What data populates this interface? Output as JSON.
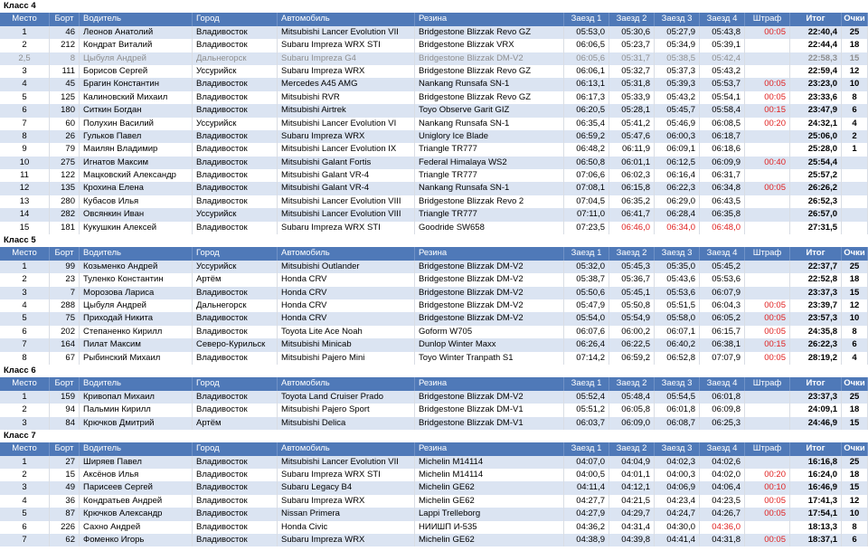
{
  "headers": [
    "Место",
    "Борт",
    "Водитель",
    "Город",
    "Автомобиль",
    "Резина",
    "Заезд 1",
    "Заезд 2",
    "Заезд 3",
    "Заезд 4",
    "Штраф",
    "Итог",
    "Очки"
  ],
  "colors": {
    "header_bg": "#4f79b8",
    "band": "#dbe4f2",
    "penalty": "#e02020",
    "withdrawn": "#8f8f8f"
  },
  "classes": [
    {
      "title": "Класс 4",
      "rows": [
        {
          "cells": [
            "1",
            "46",
            "Леонов Анатолий",
            "Владивосток",
            "Mitsubishi Lancer Evolution VII",
            "Bridgestone Blizzak Revo GZ",
            "05:53,0",
            "05:30,6",
            "05:27,9",
            "05:43,8",
            "00:05",
            "22:40,4",
            "25"
          ]
        },
        {
          "cells": [
            "2",
            "212",
            "Кондрат Виталий",
            "Владивосток",
            "Subaru Impreza WRX STI",
            "Bridgestone Blizzak VRX",
            "06:06,5",
            "05:23,7",
            "05:34,9",
            "05:39,1",
            "",
            "22:44,4",
            "18"
          ]
        },
        {
          "gray": true,
          "cells": [
            "2,5",
            "8",
            "Цыбуля Андрей",
            "Дальнегорск",
            "Subaru Impreza G4",
            "Bridgestone Blizzak DM-V2",
            "06:05,6",
            "05:31,7",
            "05:38,5",
            "05:42,4",
            "",
            "22:58,3",
            "15"
          ]
        },
        {
          "cells": [
            "3",
            "111",
            "Борисов Сергей",
            "Уссурийск",
            "Subaru Impreza WRX",
            "Bridgestone Blizzak Revo GZ",
            "06:06,1",
            "05:32,7",
            "05:37,3",
            "05:43,2",
            "",
            "22:59,4",
            "12"
          ]
        },
        {
          "cells": [
            "4",
            "45",
            "Брагин Константин",
            "Владивосток",
            "Mercedes A45 AMG",
            "Nankang Runsafa SN-1",
            "06:13,1",
            "05:31,8",
            "05:39,3",
            "05:53,7",
            "00:05",
            "23:23,0",
            "10"
          ]
        },
        {
          "cells": [
            "5",
            "125",
            "Калиновский Михаил",
            "Владивосток",
            "Mitsubishi RVR",
            "Bridgestone Blizzak Revo GZ",
            "06:17,3",
            "05:33,9",
            "05:43,2",
            "05:54,1",
            "00:05",
            "23:33,6",
            "8"
          ]
        },
        {
          "cells": [
            "6",
            "180",
            "Ситкин Богдан",
            "Владивосток",
            "Mitsubishi Airtrek",
            "Toyo Observe Garit GIZ",
            "06:20,5",
            "05:28,1",
            "05:45,7",
            "05:58,4",
            "00:15",
            "23:47,9",
            "6"
          ]
        },
        {
          "cells": [
            "7",
            "60",
            "Полухин Василий",
            "Уссурийск",
            "Mitsubishi Lancer Evolution VI",
            "Nankang Runsafa SN-1",
            "06:35,4",
            "05:41,2",
            "05:46,9",
            "06:08,5",
            "00:20",
            "24:32,1",
            "4"
          ]
        },
        {
          "cells": [
            "8",
            "26",
            "Гульков Павел",
            "Владивосток",
            "Subaru Impreza WRX",
            "Uniglory Ice Blade",
            "06:59,2",
            "05:47,6",
            "06:00,3",
            "06:18,7",
            "",
            "25:06,0",
            "2"
          ]
        },
        {
          "cells": [
            "9",
            "79",
            "Маилян Владимир",
            "Владивосток",
            "Mitsubishi Lancer Evolution IX",
            "Triangle TR777",
            "06:48,2",
            "06:11,9",
            "06:09,1",
            "06:18,6",
            "",
            "25:28,0",
            "1"
          ]
        },
        {
          "cells": [
            "10",
            "275",
            "Игнатов Максим",
            "Владивосток",
            "Mitsubishi Galant Fortis",
            "Federal Himalaya WS2",
            "06:50,8",
            "06:01,1",
            "06:12,5",
            "06:09,9",
            "00:40",
            "25:54,4",
            ""
          ]
        },
        {
          "cells": [
            "11",
            "122",
            "Мацковский Александр",
            "Владивосток",
            "Mitsubishi Galant VR-4",
            "Triangle TR777",
            "07:06,6",
            "06:02,3",
            "06:16,4",
            "06:31,7",
            "",
            "25:57,2",
            ""
          ]
        },
        {
          "cells": [
            "12",
            "135",
            "Крохина Елена",
            "Владивосток",
            "Mitsubishi Galant VR-4",
            "Nankang Runsafa SN-1",
            "07:08,1",
            "06:15,8",
            "06:22,3",
            "06:34,8",
            "00:05",
            "26:26,2",
            ""
          ]
        },
        {
          "cells": [
            "13",
            "280",
            "Кубасов Илья",
            "Владивосток",
            "Mitsubishi Lancer Evolution VIII",
            "Bridgestone Blizzak Revo 2",
            "07:04,5",
            "06:35,2",
            "06:29,0",
            "06:43,5",
            "",
            "26:52,3",
            ""
          ]
        },
        {
          "cells": [
            "14",
            "282",
            "Овсянкин Иван",
            "Уссурийск",
            "Mitsubishi Lancer Evolution VIII",
            "Triangle TR777",
            "07:11,0",
            "06:41,7",
            "06:28,4",
            "06:35,8",
            "",
            "26:57,0",
            ""
          ]
        },
        {
          "cells": [
            "15",
            "181",
            "Кукушкин Алексей",
            "Владивосток",
            "Subaru Impreza WRX STI",
            "Goodride SW658",
            "07:23,5",
            "06:46,0",
            "06:34,0",
            "06:48,0",
            "",
            "27:31,5",
            ""
          ],
          "red": [
            7,
            8,
            9
          ]
        }
      ]
    },
    {
      "title": "Класс 5",
      "rows": [
        {
          "cells": [
            "1",
            "99",
            "Козьменко Андрей",
            "Уссурийск",
            "Mitsubishi Outlander",
            "Bridgestone Blizzak DM-V2",
            "05:32,0",
            "05:45,3",
            "05:35,0",
            "05:45,2",
            "",
            "22:37,7",
            "25"
          ]
        },
        {
          "cells": [
            "2",
            "23",
            "Туленко Константин",
            "Артём",
            "Honda CRV",
            "Bridgestone Blizzak DM-V2",
            "05:38,7",
            "05:36,7",
            "05:43,6",
            "05:53,6",
            "",
            "22:52,8",
            "18"
          ]
        },
        {
          "cells": [
            "3",
            "7",
            "Морозова Лариса",
            "Владивосток",
            "Honda CRV",
            "Bridgestone Blizzak DM-V2",
            "05:50,6",
            "05:45,1",
            "05:53,6",
            "06:07,9",
            "",
            "23:37,3",
            "15"
          ]
        },
        {
          "cells": [
            "4",
            "288",
            "Цыбуля Андрей",
            "Дальнегорск",
            "Honda CRV",
            "Bridgestone Blizzak DM-V2",
            "05:47,9",
            "05:50,8",
            "05:51,5",
            "06:04,3",
            "00:05",
            "23:39,7",
            "12"
          ]
        },
        {
          "cells": [
            "5",
            "75",
            "Приходай Никита",
            "Владивосток",
            "Honda CRV",
            "Bridgestone Blizzak DM-V2",
            "05:54,0",
            "05:54,9",
            "05:58,0",
            "06:05,2",
            "00:05",
            "23:57,3",
            "10"
          ]
        },
        {
          "cells": [
            "6",
            "202",
            "Степаненко Кирилл",
            "Владивосток",
            "Toyota Lite Ace Noah",
            "Goform W705",
            "06:07,6",
            "06:00,2",
            "06:07,1",
            "06:15,7",
            "00:05",
            "24:35,8",
            "8"
          ]
        },
        {
          "cells": [
            "7",
            "164",
            "Пилат Максим",
            "Северо-Курильск",
            "Mitsubishi Minicab",
            "Dunlop Winter Maxx",
            "06:26,4",
            "06:22,5",
            "06:40,2",
            "06:38,1",
            "00:15",
            "26:22,3",
            "6"
          ]
        },
        {
          "cells": [
            "8",
            "67",
            "Рыбинский Михаил",
            "Владивосток",
            "Mitsubishi Pajero Mini",
            "Toyo Winter Tranpath S1",
            "07:14,2",
            "06:59,2",
            "06:52,8",
            "07:07,9",
            "00:05",
            "28:19,2",
            "4"
          ]
        }
      ]
    },
    {
      "title": "Класс 6",
      "rows": [
        {
          "cells": [
            "1",
            "159",
            "Кривопал Михаил",
            "Владивосток",
            "Toyota Land Cruiser Prado",
            "Bridgestone Blizzak DM-V2",
            "05:52,4",
            "05:48,4",
            "05:54,5",
            "06:01,8",
            "",
            "23:37,3",
            "25"
          ]
        },
        {
          "cells": [
            "2",
            "94",
            "Пальмин Кирилл",
            "Владивосток",
            "Mitsubishi Pajero Sport",
            "Bridgestone Blizzak DM-V1",
            "05:51,2",
            "06:05,8",
            "06:01,8",
            "06:09,8",
            "",
            "24:09,1",
            "18"
          ]
        },
        {
          "cells": [
            "3",
            "84",
            "Крючков Дмитрий",
            "Артём",
            "Mitsubishi Delica",
            "Bridgestone Blizzak DM-V1",
            "06:03,7",
            "06:09,0",
            "06:08,7",
            "06:25,3",
            "",
            "24:46,9",
            "15"
          ]
        }
      ]
    },
    {
      "title": "Класс 7",
      "rows": [
        {
          "cells": [
            "1",
            "27",
            "Ширяев Павел",
            "Владивосток",
            "Mitsubishi Lancer Evolution VII",
            "Michelin M14114",
            "04:07,0",
            "04:04,9",
            "04:02,3",
            "04:02,6",
            "",
            "16:16,8",
            "25"
          ]
        },
        {
          "cells": [
            "2",
            "15",
            "Аксёнов Илья",
            "Владивосток",
            "Subaru Impreza WRX STI",
            "Michelin M14114",
            "04:00,5",
            "04:01,1",
            "04:00,3",
            "04:02,0",
            "00:20",
            "16:24,0",
            "18"
          ]
        },
        {
          "cells": [
            "3",
            "49",
            "Парисеев Сергей",
            "Владивосток",
            "Subaru Legacy B4",
            "Michelin GE62",
            "04:11,4",
            "04:12,1",
            "04:06,9",
            "04:06,4",
            "00:10",
            "16:46,9",
            "15"
          ]
        },
        {
          "cells": [
            "4",
            "36",
            "Кондратьев Андрей",
            "Владивосток",
            "Subaru Impreza WRX",
            "Michelin GE62",
            "04:27,7",
            "04:21,5",
            "04:23,4",
            "04:23,5",
            "00:05",
            "17:41,3",
            "12"
          ]
        },
        {
          "cells": [
            "5",
            "87",
            "Крючков Александр",
            "Владивосток",
            "Nissan Primera",
            "Lappi Trelleborg",
            "04:27,9",
            "04:29,7",
            "04:24,7",
            "04:26,7",
            "00:05",
            "17:54,1",
            "10"
          ]
        },
        {
          "cells": [
            "6",
            "226",
            "Сахно Андрей",
            "Владивосток",
            "Honda Civic",
            "НИИШП И-535",
            "04:36,2",
            "04:31,4",
            "04:30,0",
            "04:36,0",
            "",
            "18:13,3",
            "8"
          ],
          "red": [
            9
          ]
        },
        {
          "cells": [
            "7",
            "62",
            "Фоменко Игорь",
            "Владивосток",
            "Subaru Impreza WRX",
            "Michelin GE62",
            "04:38,9",
            "04:39,8",
            "04:41,4",
            "04:31,8",
            "00:05",
            "18:37,1",
            "6"
          ]
        }
      ]
    }
  ]
}
